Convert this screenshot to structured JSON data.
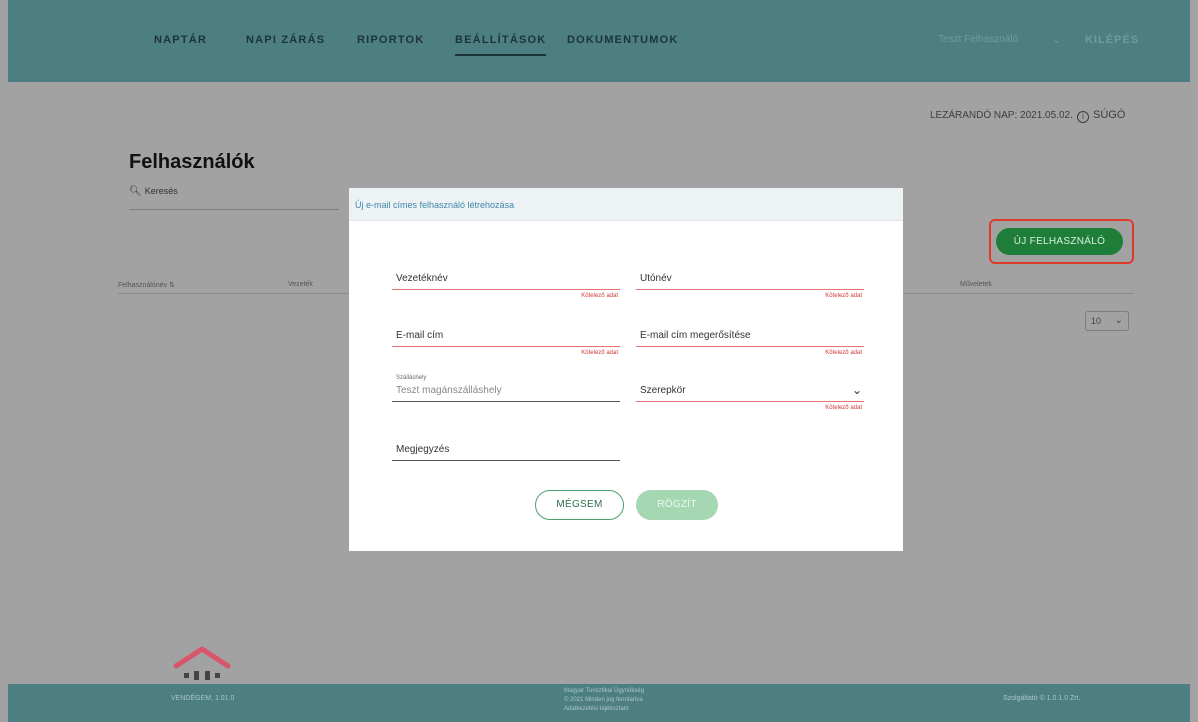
{
  "nav": {
    "items": [
      {
        "label": "NAPTÁR"
      },
      {
        "label": "NAPI ZÁRÁS"
      },
      {
        "label": "RIPORTOK"
      },
      {
        "label": "BEÁLLÍTÁSOK"
      },
      {
        "label": "DOKUMENTUMOK"
      }
    ],
    "user": "Teszt Felhasználó",
    "logout": "KILÉPÉS"
  },
  "toolbar": {
    "closing_day": "LEZÁRANDÓ NAP: 2021.05.02.",
    "help": "SÚGÓ"
  },
  "page": {
    "title": "Felhasználók",
    "search_placeholder": "Keresés",
    "columns": [
      "Felhasználónév",
      "Vezeték",
      "Műveletek"
    ],
    "sort_glyph": "⇅",
    "new_user_button": "ÚJ FELHASZNÁLÓ",
    "page_size": "10"
  },
  "modal": {
    "title": "Új e-mail címes felhasználó létrehozása",
    "fields": {
      "last_name": {
        "label": "Vezetéknév",
        "error": "Kötelező adat"
      },
      "first_name": {
        "label": "Utónév",
        "error": "Kötelező adat"
      },
      "email": {
        "label": "E-mail cím",
        "error": "Kötelező adat"
      },
      "email_confirm": {
        "label": "E-mail cím megerősítése",
        "error": "Kötelező adat"
      },
      "accommodation": {
        "label": "Szálláshely",
        "value": "Teszt magánszálláshely"
      },
      "role": {
        "label": "Szerepkör",
        "error": "Kötelező adat"
      },
      "note": {
        "label": "Megjegyzés"
      }
    },
    "cancel": "MÉGSEM",
    "save": "RÖGZÍT"
  },
  "footer": {
    "version": "VENDÉGEM, 1.01.0",
    "center_lines": [
      "Magyar Turisztikai Ügynökség",
      "© 2021 Minden jog fenntartva",
      "Adatkezelési tájékoztató"
    ],
    "right": "Szolgáltató © 1.0.1.0 Zrt."
  },
  "colors": {
    "nav_bg": "#4d7e82",
    "overlay_bg": "#a2a2a2",
    "primary_green": "#1f7d3a",
    "error_red": "#d03a3a",
    "highlight": "#e03a2b"
  }
}
